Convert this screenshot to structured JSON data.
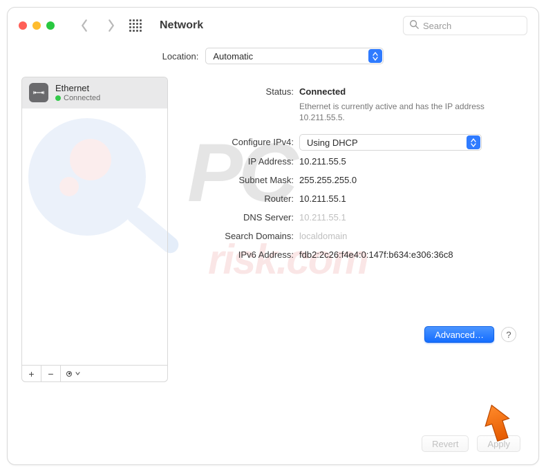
{
  "toolbar": {
    "title": "Network",
    "search_placeholder": "Search"
  },
  "location": {
    "label": "Location:",
    "value": "Automatic"
  },
  "sidebar": {
    "services": [
      {
        "name": "Ethernet",
        "status": "Connected"
      }
    ],
    "tools": {
      "add": "+",
      "remove": "−"
    }
  },
  "detail": {
    "status_label": "Status:",
    "status_value": "Connected",
    "status_desc": "Ethernet is currently active and has the IP address 10.211.55.5.",
    "configure_label": "Configure IPv4:",
    "configure_value": "Using DHCP",
    "ip_label": "IP Address:",
    "ip_value": "10.211.55.5",
    "subnet_label": "Subnet Mask:",
    "subnet_value": "255.255.255.0",
    "router_label": "Router:",
    "router_value": "10.211.55.1",
    "dns_label": "DNS Server:",
    "dns_value": "10.211.55.1",
    "search_label": "Search Domains:",
    "search_value": "localdomain",
    "ipv6_label": "IPv6 Address:",
    "ipv6_value": "fdb2:2c26:f4e4:0:147f:b634:e306:36c8",
    "advanced_label": "Advanced…",
    "help_label": "?"
  },
  "footer": {
    "revert": "Revert",
    "apply": "Apply"
  }
}
